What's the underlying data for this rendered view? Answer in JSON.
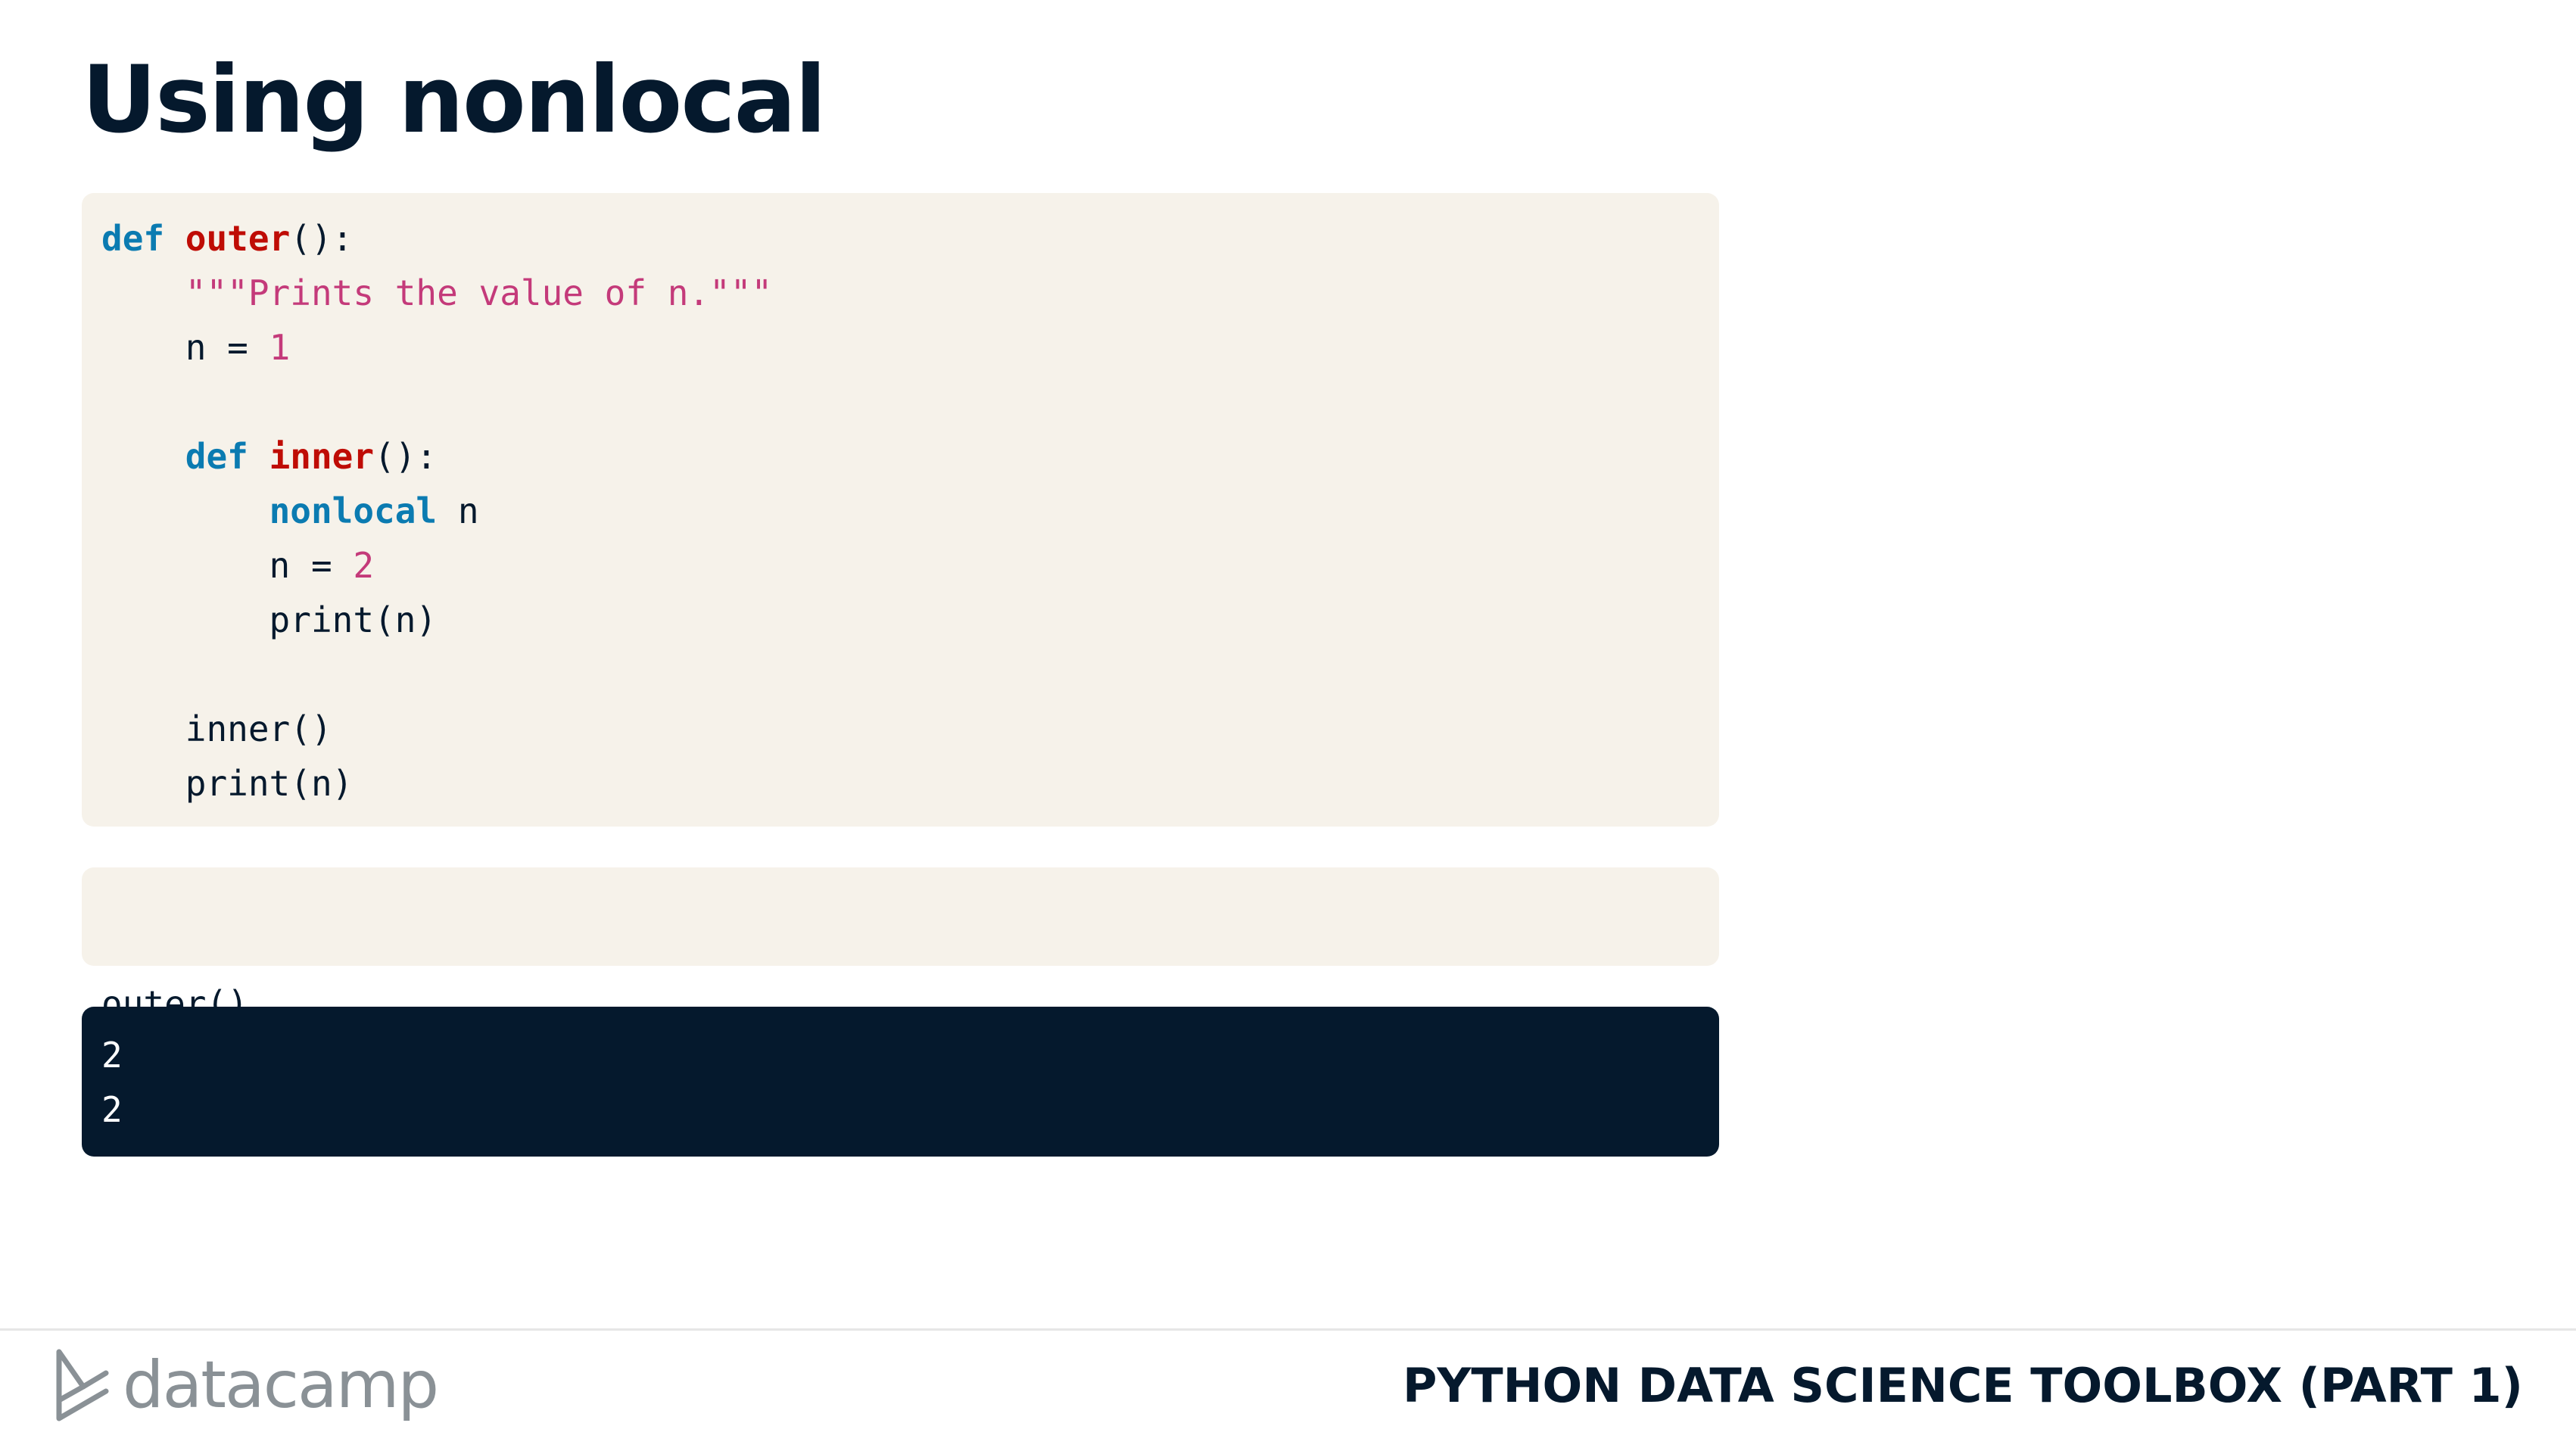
{
  "slide": {
    "title": "Using nonlocal"
  },
  "code_main": {
    "lines": [
      [
        {
          "t": "def",
          "c": "kw"
        },
        {
          "t": " ",
          "c": "plain"
        },
        {
          "t": "outer",
          "c": "fn"
        },
        {
          "t": "():",
          "c": "plain"
        }
      ],
      [
        {
          "t": "    ",
          "c": "plain"
        },
        {
          "t": "\"\"\"Prints the value of n.\"\"\"",
          "c": "str"
        }
      ],
      [
        {
          "t": "    n = ",
          "c": "plain"
        },
        {
          "t": "1",
          "c": "num"
        }
      ],
      [],
      [
        {
          "t": "    ",
          "c": "plain"
        },
        {
          "t": "def",
          "c": "kw"
        },
        {
          "t": " ",
          "c": "plain"
        },
        {
          "t": "inner",
          "c": "fn"
        },
        {
          "t": "():",
          "c": "plain"
        }
      ],
      [
        {
          "t": "        ",
          "c": "plain"
        },
        {
          "t": "nonlocal",
          "c": "kw"
        },
        {
          "t": " n",
          "c": "plain"
        }
      ],
      [
        {
          "t": "        n = ",
          "c": "plain"
        },
        {
          "t": "2",
          "c": "num"
        }
      ],
      [
        {
          "t": "        print(n)",
          "c": "plain"
        }
      ],
      [],
      [
        {
          "t": "    inner()",
          "c": "plain"
        }
      ],
      [
        {
          "t": "    print(n)",
          "c": "plain"
        }
      ]
    ]
  },
  "code_call": {
    "text": "outer()"
  },
  "output": {
    "lines": [
      "2",
      "2"
    ]
  },
  "footer": {
    "brand": "datacamp",
    "course": "PYTHON DATA SCIENCE TOOLBOX (PART 1)"
  },
  "colors": {
    "keyword": "#0b7bb1",
    "function_name": "#bf0c05",
    "string_number": "#c43a7a",
    "text": "#05192d",
    "code_background": "#f6f2ea",
    "output_background": "#05192d",
    "logo_gray": "#8a9196"
  },
  "icons": {
    "logo": "datacamp-logo-icon"
  }
}
